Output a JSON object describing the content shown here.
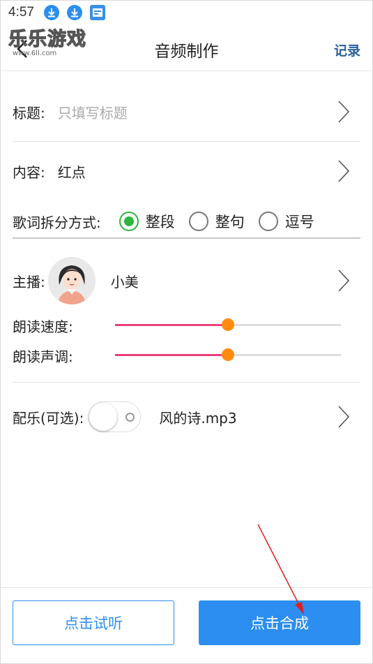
{
  "status_bar": {
    "time": "4:57",
    "icons": [
      "download-icon",
      "download-icon",
      "news-app-icon"
    ]
  },
  "watermark": {
    "title": "乐乐游戏",
    "url": "www.6ll.com"
  },
  "header": {
    "back_icon": "chevron-left-icon",
    "title": "音频制作",
    "record_label": "记录"
  },
  "form": {
    "title_row": {
      "label": "标题:",
      "placeholder": "只填写标题"
    },
    "content_row": {
      "label": "内容:",
      "value": "红点"
    },
    "split_row": {
      "label": "歌词拆分方式:",
      "options": [
        {
          "label": "整段",
          "checked": true
        },
        {
          "label": "整句",
          "checked": false
        },
        {
          "label": "逗号",
          "checked": false
        }
      ]
    },
    "host_row": {
      "label": "主播:",
      "name": "小美"
    },
    "speed_row": {
      "label": "朗读速度:",
      "value_percent": 50
    },
    "pitch_row": {
      "label": "朗读声调:",
      "value_percent": 50
    },
    "music_row": {
      "label": "配乐(可选):",
      "toggle_on": false,
      "file": "风的诗.mp3"
    }
  },
  "bottom": {
    "preview_label": "点击试听",
    "compose_label": "点击合成"
  },
  "colors": {
    "accent": "#2b8ef0",
    "radio_checked": "#2fb53e",
    "slider_fill": "#e8407a",
    "slider_thumb": "#ff8b12",
    "annotation_arrow": "#e02020"
  }
}
